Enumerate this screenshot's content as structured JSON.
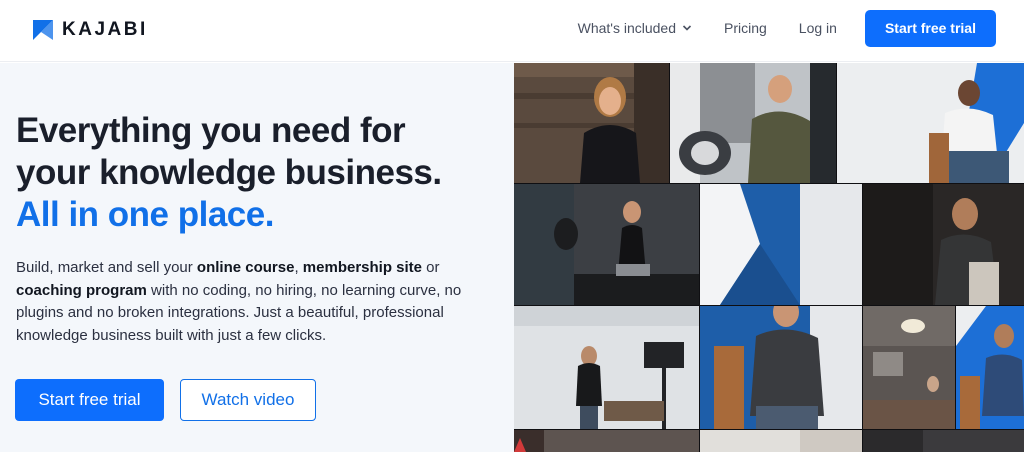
{
  "brand": {
    "name": "KAJABI",
    "color": "#1170e8"
  },
  "nav": {
    "whats_included": "What's included",
    "pricing": "Pricing",
    "login": "Log in",
    "cta": "Start free trial"
  },
  "hero": {
    "headline_line1": "Everything you need for",
    "headline_line2": "your knowledge business.",
    "headline_accent": "All in one place.",
    "body": {
      "p1": "Build, market and sell your ",
      "b1": "online course",
      "p2": ", ",
      "b2": "membership site",
      "p3": " or ",
      "b3": "coaching program",
      "p4": " with no coding, no hiring, no learning curve, no plugins and no broken integrations. Just a beautiful, professional knowledge business built with just a few clicks."
    },
    "primary_button": "Start free trial",
    "secondary_button": "Watch video"
  },
  "photo_grid": {
    "tiles": [
      {
        "name": "woman-smiling-photo"
      },
      {
        "name": "man-with-motorcycle-photo"
      },
      {
        "name": "man-seated-talking-photo"
      },
      {
        "name": "woman-seated-studio-photo"
      },
      {
        "name": "blue-wall-decor-photo"
      },
      {
        "name": "man-seated-dark-photo"
      },
      {
        "name": "woman-filming-set-photo"
      },
      {
        "name": "man-gesturing-chair-photo"
      },
      {
        "name": "woman-office-photo"
      },
      {
        "name": "man-blue-backdrop-photo"
      }
    ]
  }
}
